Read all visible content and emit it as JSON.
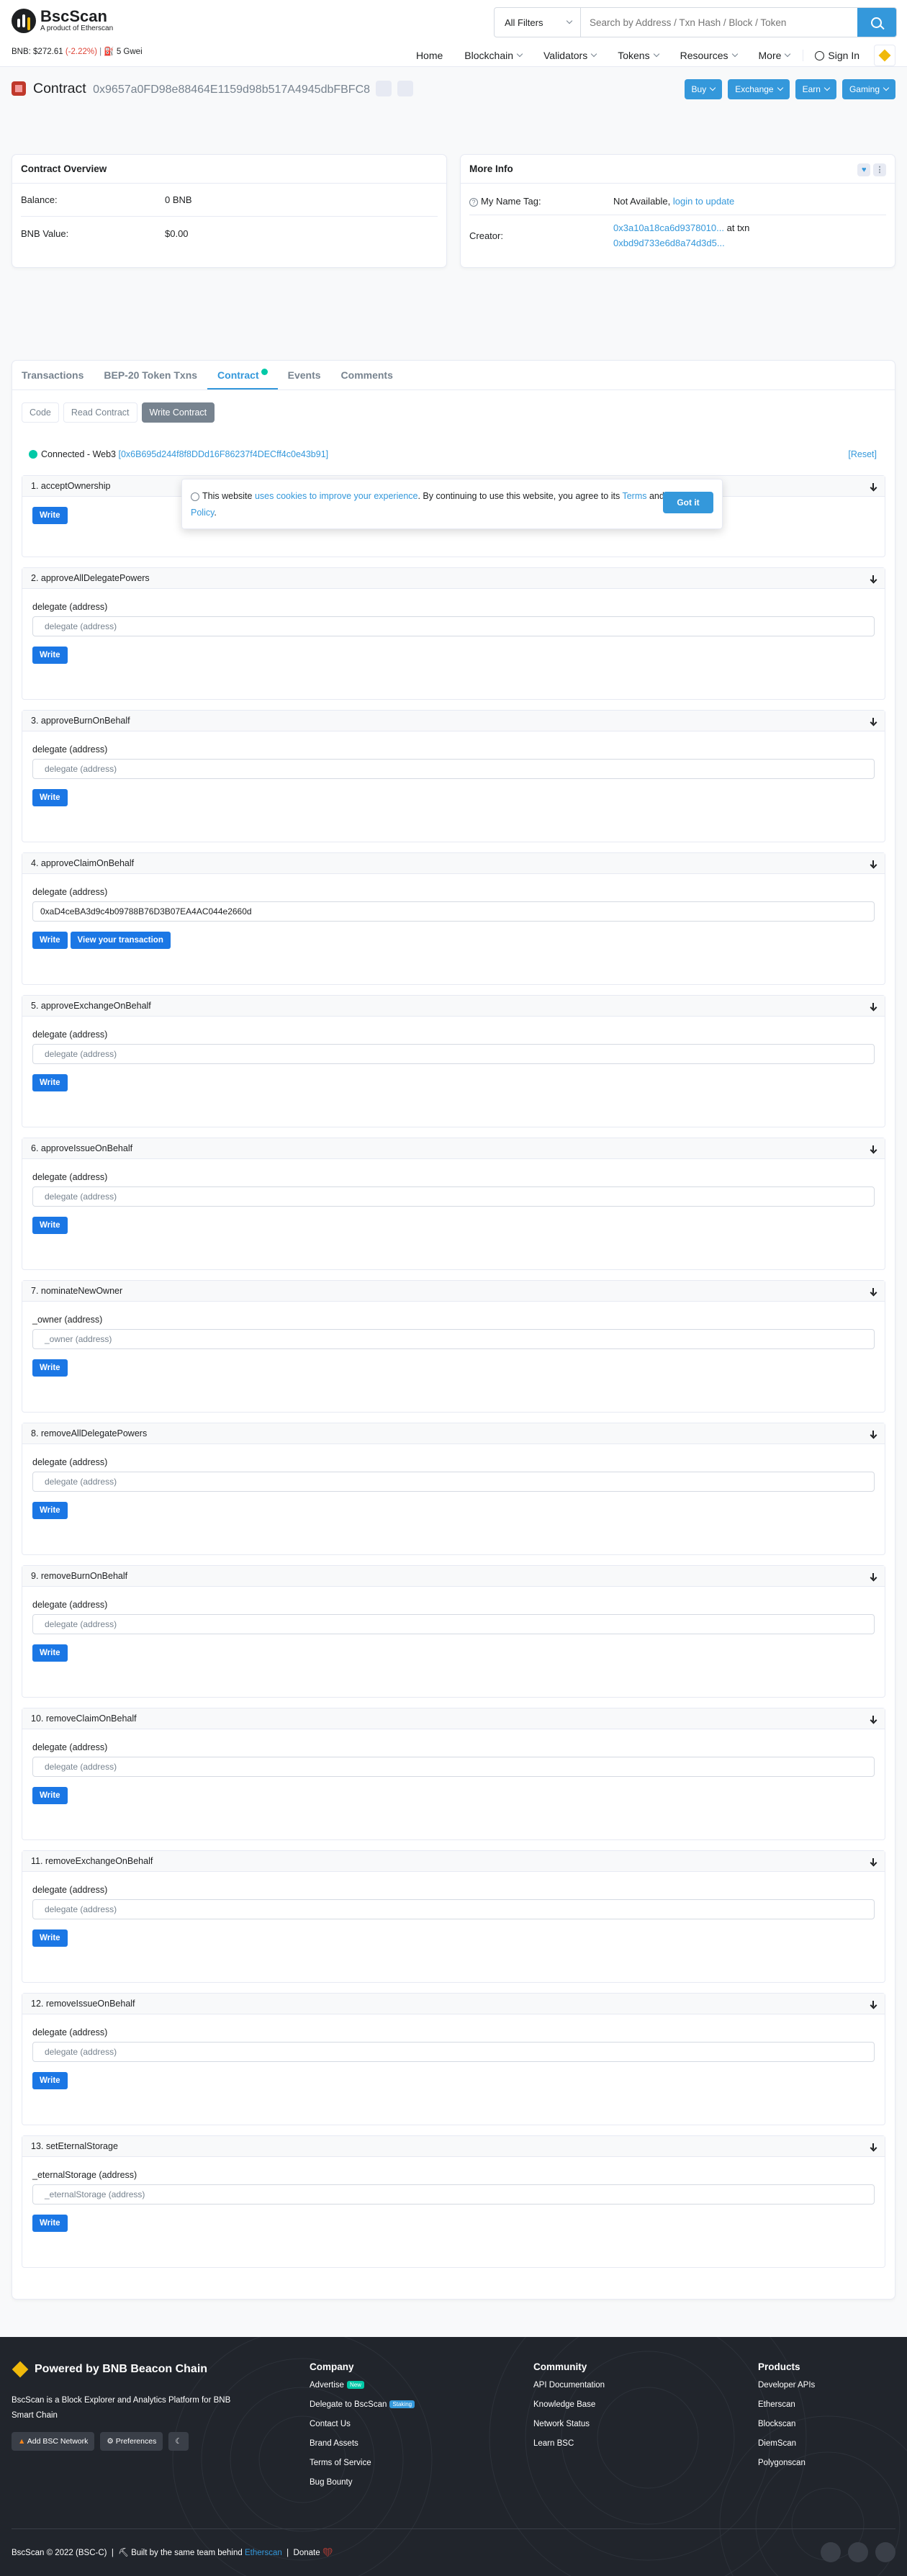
{
  "header": {
    "logo_name": "BscScan",
    "logo_sub": "A product of Etherscan",
    "price_label": "BNB: $272.61",
    "price_change": "(-2.22%)",
    "gas": "5 Gwei",
    "filter": "All Filters",
    "search_placeholder": "Search by Address / Txn Hash / Block / Token",
    "nav": [
      "Home",
      "Blockchain",
      "Validators",
      "Tokens",
      "Resources",
      "More"
    ],
    "signin": "Sign In"
  },
  "contract": {
    "title": "Contract",
    "address": "0x9657a0FD98e88464E1159d98b517A4945dbFBFC8",
    "actions": [
      "Buy",
      "Exchange",
      "Earn",
      "Gaming"
    ]
  },
  "overview": {
    "title": "Contract Overview",
    "rows": [
      {
        "label": "Balance:",
        "value": "0 BNB"
      },
      {
        "label": "BNB Value:",
        "value": "$0.00"
      }
    ]
  },
  "more_info": {
    "title": "More Info",
    "name_tag_label": "My Name Tag:",
    "name_tag_value": "Not Available,",
    "name_tag_link": "login to update",
    "creator_label": "Creator:",
    "creator_addr": "0x3a10a18ca6d9378010...",
    "creator_at": "at txn",
    "creator_txn": "0xbd9d733e6d8a74d3d5..."
  },
  "tabs": [
    "Transactions",
    "BEP-20 Token Txns",
    "Contract",
    "Events",
    "Comments"
  ],
  "subtabs": [
    "Code",
    "Read Contract",
    "Write Contract"
  ],
  "connected": "Connected - Web3",
  "connected_addr": "[0x6B695d244f8f8DDd16F86237f4DECff4c0e43b91]",
  "reset": "[Reset]",
  "cookie": {
    "pre": "This website",
    "link": "uses cookies to improve your experience",
    "mid": ". By continuing to use this website, you agree to its",
    "terms": "Terms",
    "and": "and",
    "privacy": "Privacy Policy",
    "end": ".",
    "button": "Got it"
  },
  "functions": [
    {
      "name": "1. acceptOwnership",
      "label": "",
      "placeholder": "",
      "value": ""
    },
    {
      "name": "2. approveAllDelegatePowers",
      "label": "delegate (address)",
      "placeholder": "delegate (address)",
      "value": ""
    },
    {
      "name": "3. approveBurnOnBehalf",
      "label": "delegate (address)",
      "placeholder": "delegate (address)",
      "value": ""
    },
    {
      "name": "4. approveClaimOnBehalf",
      "label": "delegate (address)",
      "placeholder": "",
      "value": "0xaD4ceBA3d9c4b09788B76D3B07EA4AC044e2660d"
    },
    {
      "name": "5. approveExchangeOnBehalf",
      "label": "delegate (address)",
      "placeholder": "delegate (address)",
      "value": ""
    },
    {
      "name": "6. approveIssueOnBehalf",
      "label": "delegate (address)",
      "placeholder": "delegate (address)",
      "value": ""
    },
    {
      "name": "7. nominateNewOwner",
      "label": "_owner (address)",
      "placeholder": "_owner (address)",
      "value": ""
    },
    {
      "name": "8. removeAllDelegatePowers",
      "label": "delegate (address)",
      "placeholder": "delegate (address)",
      "value": ""
    },
    {
      "name": "9. removeBurnOnBehalf",
      "label": "delegate (address)",
      "placeholder": "delegate (address)",
      "value": ""
    },
    {
      "name": "10. removeClaimOnBehalf",
      "label": "delegate (address)",
      "placeholder": "delegate (address)",
      "value": ""
    },
    {
      "name": "11. removeExchangeOnBehalf",
      "label": "delegate (address)",
      "placeholder": "delegate (address)",
      "value": ""
    },
    {
      "name": "12. removeIssueOnBehalf",
      "label": "delegate (address)",
      "placeholder": "delegate (address)",
      "value": ""
    },
    {
      "name": "13. setEternalStorage",
      "label": "_eternalStorage (address)",
      "placeholder": "_eternalStorage (address)",
      "value": ""
    }
  ],
  "write_label": "Write",
  "view_tx_label": "View your transaction",
  "footer": {
    "brand": "Powered by BNB Beacon Chain",
    "desc": "BscScan is a Block Explorer and Analytics Platform for BNB Smart Chain",
    "buttons": [
      "Add BSC Network",
      "Preferences"
    ],
    "company_title": "Company",
    "company": [
      "Advertise",
      "Delegate to BscScan",
      "Contact Us",
      "Brand Assets",
      "Terms of Service",
      "Bug Bounty"
    ],
    "badge_new": "New",
    "badge_staking": "Staking",
    "community_title": "Community",
    "community": [
      "API Documentation",
      "Knowledge Base",
      "Network Status",
      "Learn BSC"
    ],
    "products_title": "Products",
    "products": [
      "Developer APIs",
      "Etherscan",
      "Blockscan",
      "DiemScan",
      "Polygonscan"
    ],
    "copyright": "BscScan © 2022 (BSC-C)",
    "built": "Built by the same team behind",
    "built_link": "Etherscan",
    "donate": "Donate"
  }
}
